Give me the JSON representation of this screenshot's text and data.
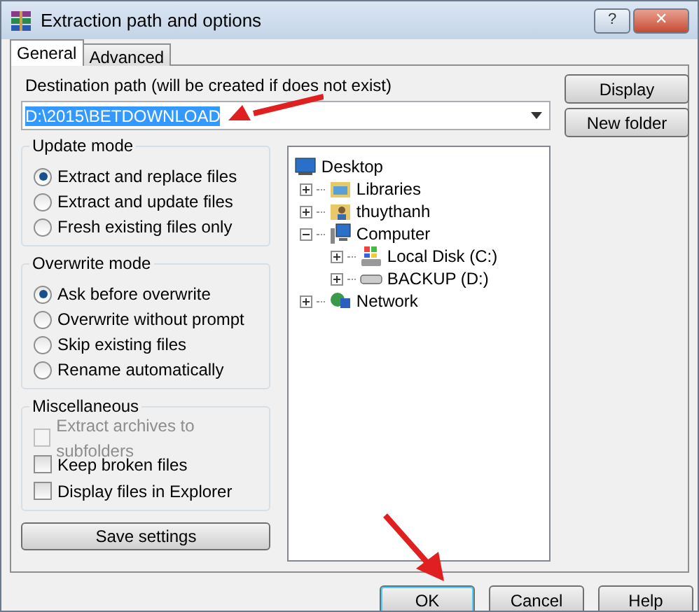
{
  "window": {
    "title": "Extraction path and options"
  },
  "title_buttons": [
    {
      "kind": "help",
      "label": "?"
    },
    {
      "kind": "close",
      "label": "✕"
    }
  ],
  "tabs": [
    {
      "label": "General",
      "selected": true
    },
    {
      "label": "Advanced",
      "selected": false
    }
  ],
  "destination": {
    "label": "Destination path (will be created if does not exist)",
    "value": "D:\\2015\\BETDOWNLOAD"
  },
  "side_buttons": [
    "Display",
    "New folder"
  ],
  "update_mode": {
    "title": "Update mode",
    "options": [
      {
        "label": "Extract and replace files",
        "selected": true
      },
      {
        "label": "Extract and update files",
        "selected": false
      },
      {
        "label": "Fresh existing files only",
        "selected": false
      }
    ]
  },
  "overwrite_mode": {
    "title": "Overwrite mode",
    "options": [
      {
        "label": "Ask before overwrite",
        "selected": true
      },
      {
        "label": "Overwrite without prompt",
        "selected": false
      },
      {
        "label": "Skip existing files",
        "selected": false
      },
      {
        "label": "Rename automatically",
        "selected": false
      }
    ]
  },
  "miscellaneous": {
    "title": "Miscellaneous",
    "options": [
      {
        "label": "Extract archives to subfolders",
        "checked": false,
        "disabled": true
      },
      {
        "label": "Keep broken files",
        "checked": false,
        "disabled": false
      },
      {
        "label": "Display files in Explorer",
        "checked": false,
        "disabled": false
      }
    ]
  },
  "save_button": "Save settings",
  "tree": {
    "label": "Desktop",
    "kind": "desktop",
    "children": [
      {
        "label": "Libraries",
        "kind": "library",
        "expanded": false
      },
      {
        "label": "thuythanh",
        "kind": "user",
        "expanded": false
      },
      {
        "label": "Computer",
        "kind": "computer",
        "expanded": true,
        "children": [
          {
            "label": "Local Disk (C:)",
            "kind": "system-drive",
            "expanded": false
          },
          {
            "label": "BACKUP (D:)",
            "kind": "drive",
            "expanded": false
          }
        ]
      },
      {
        "label": "Network",
        "kind": "network",
        "expanded": false
      }
    ]
  },
  "buttons": [
    {
      "label": "OK",
      "default": true
    },
    {
      "label": "Cancel",
      "default": false
    },
    {
      "label": "Help",
      "default": false
    }
  ]
}
